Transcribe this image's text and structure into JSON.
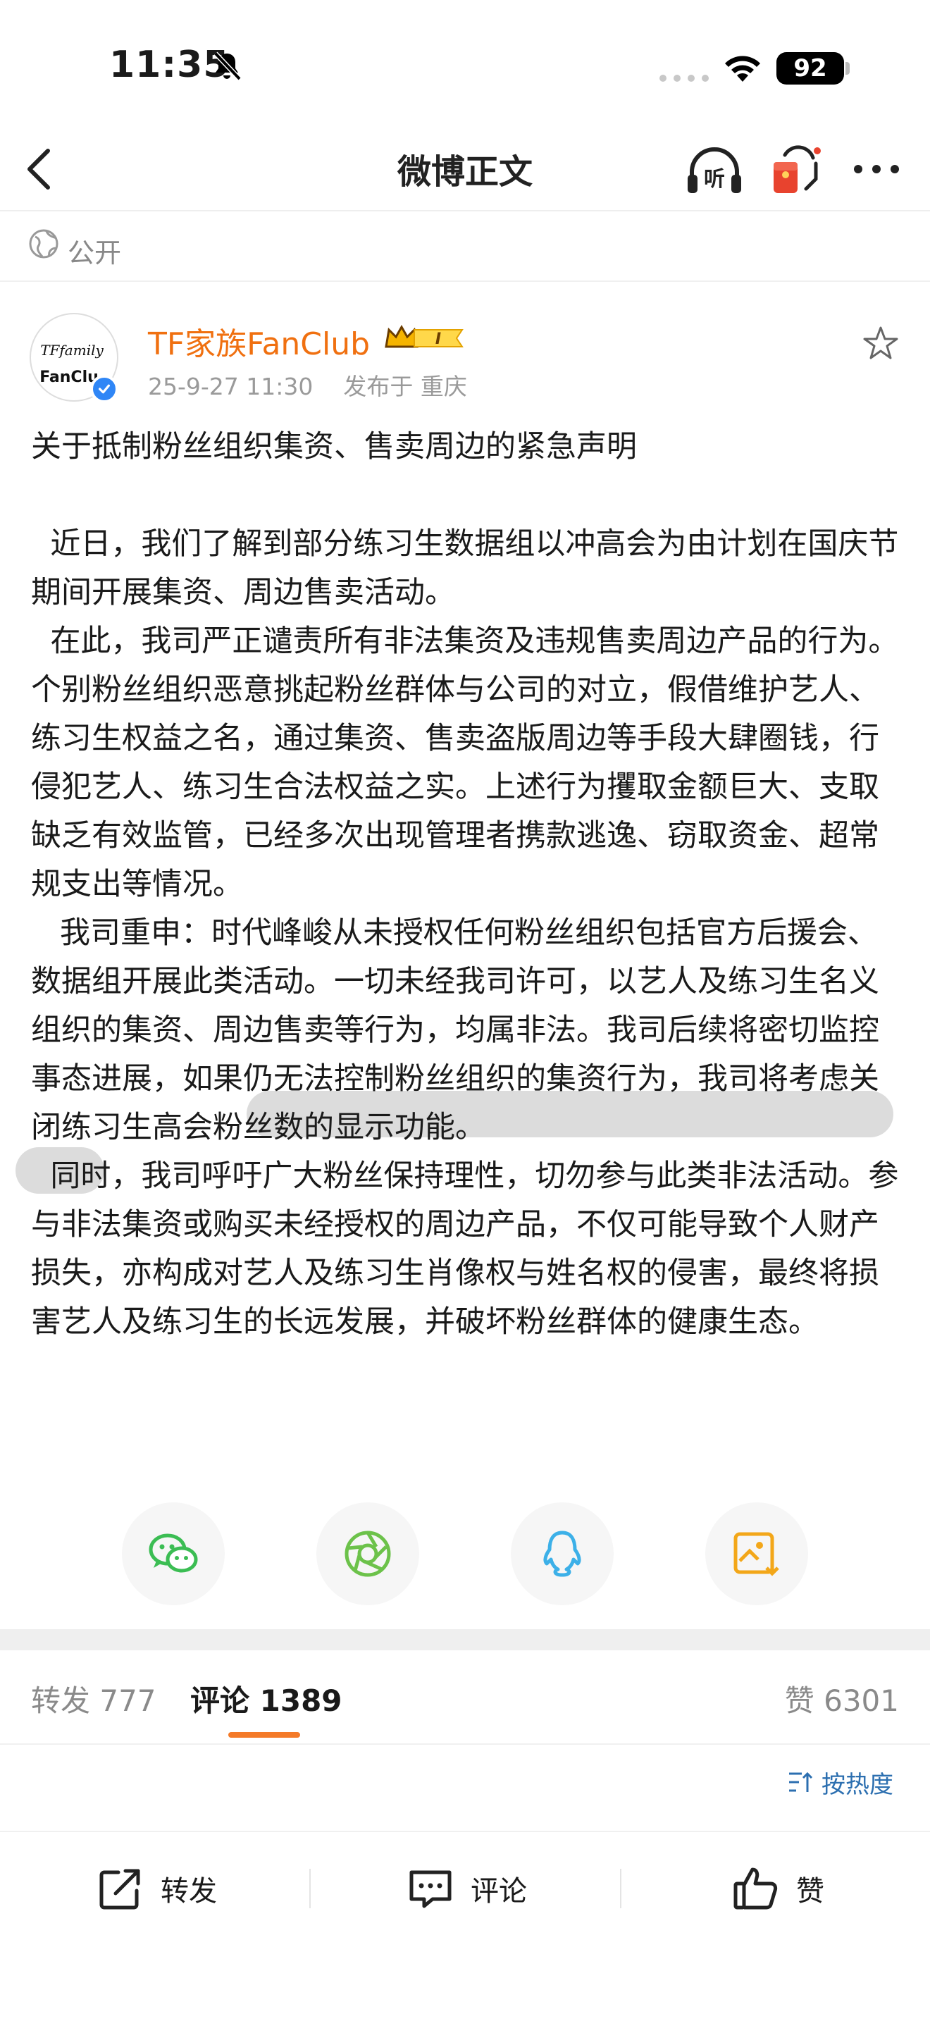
{
  "status_bar": {
    "time": "11:35",
    "battery": "92"
  },
  "nav": {
    "title": "微博正文",
    "listen_icon_text": "听"
  },
  "visibility": {
    "label": "公开"
  },
  "author": {
    "name": "TF家族FanClub",
    "avatar_text_top": "TFfamily",
    "avatar_text_bottom": "FanClu",
    "rank_badge": "I",
    "timestamp": "25-9-27 11:30",
    "location": "发布于 重庆"
  },
  "post": {
    "paragraphs": [
      "关于抵制粉丝组织集资、售卖周边的紧急声明",
      "",
      "  近日，我们了解到部分练习生数据组以冲高会为由计划在国庆节期间开展集资、周边售卖活动。",
      "  在此，我司严正谴责所有非法集资及违规售卖周边产品的行为。个别粉丝组织恶意挑起粉丝群体与公司的对立，假借维护艺人、练习生权益之名，通过集资、售卖盗版周边等手段大肆圈钱，行侵犯艺人、练习生合法权益之实。上述行为攫取金额巨大、支取缺乏有效监管，已经多次出现管理者携款逃逸、窃取资金、超常规支出等情况。",
      "   我司重申：时代峰峻从未授权任何粉丝组织包括官方后援会、数据组开展此类活动。一切未经我司许可，以艺人及练习生名义组织的集资、周边售卖等行为，均属非法。我司后续将密切监控事态进展，如果仍无法控制粉丝组织的集资行为，我司将考虑关闭练习生高会粉丝数的显示功能。",
      "  同时，我司呼吁广大粉丝保持理性，切勿参与此类非法活动。参与非法集资或购买未经授权的周边产品，不仅可能导致个人财产损失，亦构成对艺人及练习生肖像权与姓名权的侵害，最终将损害艺人及练习生的长远发展，并破坏粉丝群体的健康生态。"
    ]
  },
  "share": {
    "icons": [
      "wechat-icon",
      "moments-icon",
      "qq-icon",
      "save-image-icon"
    ]
  },
  "tabs": {
    "repost": "转发 777",
    "comment": "评论 1389",
    "like": "赞 6301"
  },
  "sort": {
    "label": "按热度"
  },
  "bottom_bar": {
    "repost": "转发",
    "comment": "评论",
    "like": "赞"
  },
  "colors": {
    "accent_orange": "#f47a28",
    "author_orange": "#f07010",
    "link_blue": "#2c6fb0"
  }
}
